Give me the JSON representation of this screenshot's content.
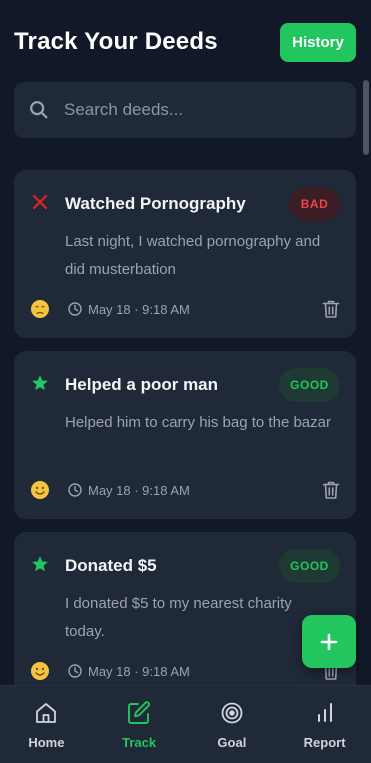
{
  "header": {
    "title": "Track Your Deeds",
    "history_label": "History"
  },
  "search": {
    "placeholder": "Search deeds...",
    "icon": "search-icon"
  },
  "colors": {
    "accent": "#22c55e",
    "bad": "#ef4444",
    "background": "#111827",
    "card": "#1f2937"
  },
  "deeds": [
    {
      "title": "Watched Pornography",
      "type": "bad",
      "badge": "BAD",
      "icon": "x-icon",
      "description": "Last night, I watched pornography and did musterbation",
      "mood": "sad-face-icon",
      "time": "May 18 · 9:18 AM"
    },
    {
      "title": "Helped a poor man",
      "type": "good",
      "badge": "GOOD",
      "icon": "star-icon",
      "description": "Helped him to carry his bag to the bazar",
      "mood": "smile-face-icon",
      "time": "May 18 · 9:18 AM"
    },
    {
      "title": "Donated $5",
      "type": "good",
      "badge": "GOOD",
      "icon": "star-icon",
      "description": "I donated $5 to my nearest charity today.",
      "mood": "smile-face-icon",
      "time": "May 18 · 9:18 AM"
    }
  ],
  "fab": {
    "label": "+"
  },
  "nav": {
    "active": "Track",
    "items": [
      {
        "label": "Home",
        "icon": "home-icon"
      },
      {
        "label": "Track",
        "icon": "edit-icon"
      },
      {
        "label": "Goal",
        "icon": "target-icon"
      },
      {
        "label": "Report",
        "icon": "bar-chart-icon"
      }
    ]
  }
}
